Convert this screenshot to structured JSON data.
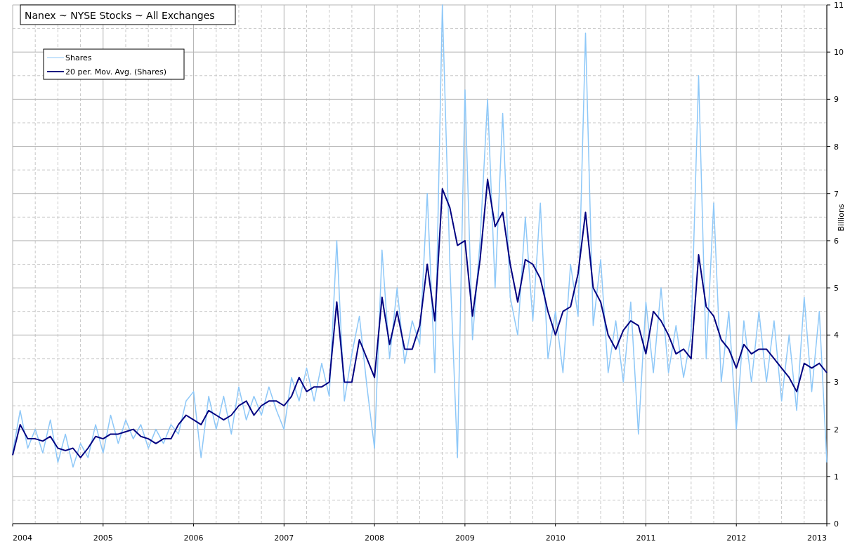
{
  "chart": {
    "chart_data": {
      "type": "line",
      "title": "Nanex ~ NYSE Stocks ~ All Exchanges",
      "ylabel": "Billions",
      "x": [
        2004,
        2004.083,
        2004.167,
        2004.25,
        2004.333,
        2004.417,
        2004.5,
        2004.583,
        2004.667,
        2004.75,
        2004.833,
        2004.917,
        2005,
        2005.083,
        2005.167,
        2005.25,
        2005.333,
        2005.417,
        2005.5,
        2005.583,
        2005.667,
        2005.75,
        2005.833,
        2005.917,
        2006,
        2006.083,
        2006.167,
        2006.25,
        2006.333,
        2006.417,
        2006.5,
        2006.583,
        2006.667,
        2006.75,
        2006.833,
        2006.917,
        2007,
        2007.083,
        2007.167,
        2007.25,
        2007.333,
        2007.417,
        2007.5,
        2007.583,
        2007.667,
        2007.75,
        2007.833,
        2007.917,
        2008,
        2008.083,
        2008.167,
        2008.25,
        2008.333,
        2008.417,
        2008.5,
        2008.583,
        2008.667,
        2008.75,
        2008.833,
        2008.917,
        2009,
        2009.083,
        2009.167,
        2009.25,
        2009.333,
        2009.417,
        2009.5,
        2009.583,
        2009.667,
        2009.75,
        2009.833,
        2009.917,
        2010,
        2010.083,
        2010.167,
        2010.25,
        2010.333,
        2010.417,
        2010.5,
        2010.583,
        2010.667,
        2010.75,
        2010.833,
        2010.917,
        2011,
        2011.083,
        2011.167,
        2011.25,
        2011.333,
        2011.417,
        2011.5,
        2011.583,
        2011.667,
        2011.75,
        2011.833,
        2011.917,
        2012,
        2012.083,
        2012.167,
        2012.25,
        2012.333,
        2012.417,
        2012.5,
        2012.583,
        2012.667,
        2012.75,
        2012.833,
        2012.917,
        2013
      ],
      "series": [
        {
          "name": "Shares",
          "color": "#8ec8f8",
          "values": [
            1.5,
            2.4,
            1.6,
            2.0,
            1.5,
            2.2,
            1.3,
            1.9,
            1.2,
            1.7,
            1.4,
            2.1,
            1.5,
            2.3,
            1.7,
            2.2,
            1.8,
            2.1,
            1.6,
            2.0,
            1.7,
            2.1,
            1.9,
            2.6,
            2.8,
            1.4,
            2.7,
            2.0,
            2.7,
            1.9,
            2.9,
            2.2,
            2.7,
            2.3,
            2.9,
            2.4,
            2.0,
            3.1,
            2.6,
            3.3,
            2.6,
            3.4,
            2.7,
            6.0,
            2.6,
            3.6,
            4.4,
            2.9,
            1.6,
            5.8,
            3.5,
            5.0,
            3.4,
            4.3,
            3.8,
            7.0,
            3.2,
            11.0,
            5.5,
            1.4,
            9.2,
            3.9,
            6.0,
            9.0,
            5.0,
            8.7,
            4.8,
            4.0,
            6.5,
            4.3,
            6.8,
            3.5,
            4.5,
            3.2,
            5.5,
            4.4,
            10.4,
            4.2,
            5.6,
            3.2,
            4.3,
            3.0,
            4.7,
            1.9,
            4.7,
            3.2,
            5.0,
            3.2,
            4.2,
            3.1,
            4.0,
            9.5,
            3.5,
            6.8,
            3.0,
            4.5,
            2.0,
            4.3,
            3.0,
            4.5,
            3.0,
            4.3,
            2.6,
            4.0,
            2.4,
            4.8,
            2.8,
            4.5,
            1.3
          ]
        },
        {
          "name": "20 per. Mov. Avg. (Shares)",
          "color": "#000080",
          "values": [
            1.45,
            2.1,
            1.8,
            1.8,
            1.75,
            1.85,
            1.6,
            1.55,
            1.6,
            1.4,
            1.6,
            1.85,
            1.8,
            1.9,
            1.9,
            1.95,
            2.0,
            1.85,
            1.8,
            1.7,
            1.8,
            1.8,
            2.1,
            2.3,
            2.2,
            2.1,
            2.4,
            2.3,
            2.2,
            2.3,
            2.5,
            2.6,
            2.3,
            2.5,
            2.6,
            2.6,
            2.5,
            2.7,
            3.1,
            2.8,
            2.9,
            2.9,
            3.0,
            4.7,
            3.0,
            3.0,
            3.9,
            3.5,
            3.1,
            4.8,
            3.8,
            4.5,
            3.7,
            3.7,
            4.2,
            5.5,
            4.3,
            7.1,
            6.7,
            5.9,
            6.0,
            4.4,
            5.6,
            7.3,
            6.3,
            6.6,
            5.5,
            4.7,
            5.6,
            5.5,
            5.2,
            4.5,
            4.0,
            4.5,
            4.6,
            5.3,
            6.6,
            5.0,
            4.7,
            4.0,
            3.7,
            4.1,
            4.3,
            4.2,
            3.6,
            4.5,
            4.3,
            4.0,
            3.6,
            3.7,
            3.5,
            5.7,
            4.6,
            4.4,
            3.9,
            3.7,
            3.3,
            3.8,
            3.6,
            3.7,
            3.7,
            3.5,
            3.3,
            3.1,
            2.8,
            3.4,
            3.3,
            3.4,
            3.2
          ]
        }
      ],
      "grid": true,
      "legend": true,
      "xlim": [
        2004,
        2013
      ],
      "ylim": [
        0,
        11
      ],
      "xticks": [
        2004,
        2005,
        2006,
        2007,
        2008,
        2009,
        2010,
        2011,
        2012,
        2013
      ],
      "yticks": [
        0,
        1,
        2,
        3,
        4,
        5,
        6,
        7,
        8,
        9,
        10,
        11
      ]
    }
  }
}
